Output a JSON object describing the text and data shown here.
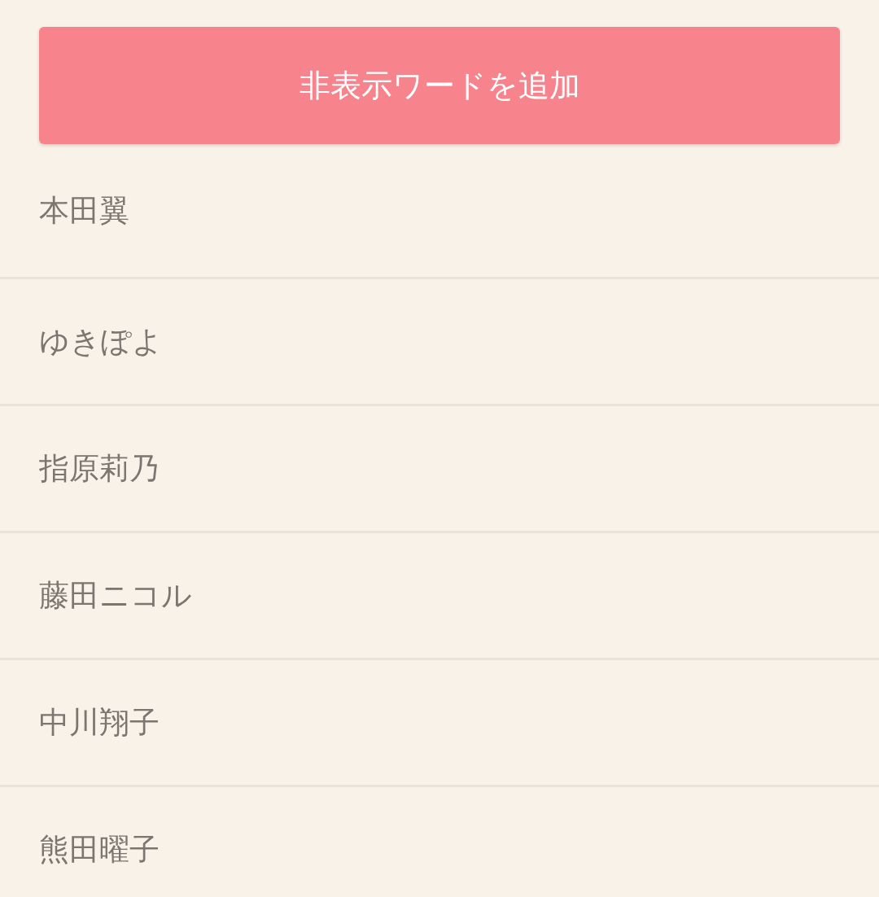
{
  "add_button": {
    "label": "非表示ワードを追加"
  },
  "hidden_words": [
    {
      "text": "本田翼"
    },
    {
      "text": "ゆきぽよ"
    },
    {
      "text": "指原莉乃"
    },
    {
      "text": "藤田ニコル"
    },
    {
      "text": "中川翔子"
    },
    {
      "text": "熊田曜子"
    }
  ]
}
